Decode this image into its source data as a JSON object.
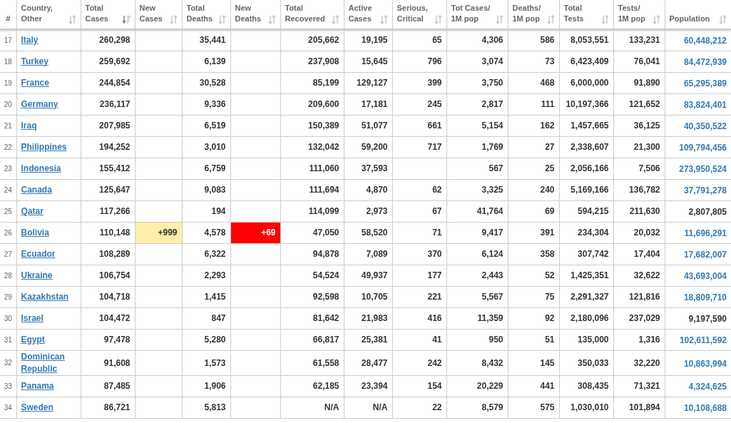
{
  "columns": [
    {
      "label": "#",
      "kind": "rank"
    },
    {
      "label": "Country,\nOther",
      "kind": "country",
      "sorted": false
    },
    {
      "label": "Total\nCases",
      "kind": "number",
      "sorted": true
    },
    {
      "label": "New\nCases",
      "kind": "new_cases",
      "sorted": false
    },
    {
      "label": "Total\nDeaths",
      "kind": "number",
      "sorted": false
    },
    {
      "label": "New\nDeaths",
      "kind": "new_deaths",
      "sorted": false
    },
    {
      "label": "Total\nRecovered",
      "kind": "number",
      "sorted": false
    },
    {
      "label": "Active\nCases",
      "kind": "number",
      "sorted": false
    },
    {
      "label": "Serious,\nCritical",
      "kind": "number",
      "sorted": false
    },
    {
      "label": "Tot Cases/\n1M pop",
      "kind": "number",
      "sorted": false
    },
    {
      "label": "Deaths/\n1M pop",
      "kind": "number",
      "sorted": false
    },
    {
      "label": "Total\nTests",
      "kind": "number",
      "sorted": false
    },
    {
      "label": "Tests/\n1M pop",
      "kind": "number",
      "sorted": false
    },
    {
      "label": "Population",
      "kind": "population",
      "sorted": false
    }
  ],
  "rows": [
    {
      "rank": "17",
      "country": "Italy",
      "total_cases": "260,298",
      "total_deaths": "35,441",
      "total_recovered": "205,662",
      "active_cases": "19,195",
      "serious_critical": "65",
      "tot_cases_1m": "4,306",
      "deaths_1m": "586",
      "total_tests": "8,053,551",
      "tests_1m": "133,231",
      "population": "60,448,212",
      "population_linked": true
    },
    {
      "rank": "18",
      "country": "Turkey",
      "total_cases": "259,692",
      "total_deaths": "6,139",
      "total_recovered": "237,908",
      "active_cases": "15,645",
      "serious_critical": "796",
      "tot_cases_1m": "3,074",
      "deaths_1m": "73",
      "total_tests": "6,423,409",
      "tests_1m": "76,041",
      "population": "84,472,939",
      "population_linked": true
    },
    {
      "rank": "19",
      "country": "France",
      "total_cases": "244,854",
      "total_deaths": "30,528",
      "total_recovered": "85,199",
      "active_cases": "129,127",
      "serious_critical": "399",
      "tot_cases_1m": "3,750",
      "deaths_1m": "468",
      "total_tests": "6,000,000",
      "tests_1m": "91,890",
      "population": "65,295,389",
      "population_linked": true
    },
    {
      "rank": "20",
      "country": "Germany",
      "total_cases": "236,117",
      "total_deaths": "9,336",
      "total_recovered": "209,600",
      "active_cases": "17,181",
      "serious_critical": "245",
      "tot_cases_1m": "2,817",
      "deaths_1m": "111",
      "total_tests": "10,197,366",
      "tests_1m": "121,652",
      "population": "83,824,401",
      "population_linked": true
    },
    {
      "rank": "21",
      "country": "Iraq",
      "total_cases": "207,985",
      "total_deaths": "6,519",
      "total_recovered": "150,389",
      "active_cases": "51,077",
      "serious_critical": "661",
      "tot_cases_1m": "5,154",
      "deaths_1m": "162",
      "total_tests": "1,457,665",
      "tests_1m": "36,125",
      "population": "40,350,522",
      "population_linked": true
    },
    {
      "rank": "22",
      "country": "Philippines",
      "total_cases": "194,252",
      "total_deaths": "3,010",
      "total_recovered": "132,042",
      "active_cases": "59,200",
      "serious_critical": "717",
      "tot_cases_1m": "1,769",
      "deaths_1m": "27",
      "total_tests": "2,338,607",
      "tests_1m": "21,300",
      "population": "109,794,456",
      "population_linked": true
    },
    {
      "rank": "23",
      "country": "Indonesia",
      "total_cases": "155,412",
      "total_deaths": "6,759",
      "total_recovered": "111,060",
      "active_cases": "37,593",
      "tot_cases_1m": "567",
      "deaths_1m": "25",
      "total_tests": "2,056,166",
      "tests_1m": "7,506",
      "population": "273,950,524",
      "population_linked": true
    },
    {
      "rank": "24",
      "country": "Canada",
      "total_cases": "125,647",
      "total_deaths": "9,083",
      "total_recovered": "111,694",
      "active_cases": "4,870",
      "serious_critical": "62",
      "tot_cases_1m": "3,325",
      "deaths_1m": "240",
      "total_tests": "5,169,166",
      "tests_1m": "136,782",
      "population": "37,791,278",
      "population_linked": true
    },
    {
      "rank": "25",
      "country": "Qatar",
      "total_cases": "117,266",
      "total_deaths": "194",
      "total_recovered": "114,099",
      "active_cases": "2,973",
      "serious_critical": "67",
      "tot_cases_1m": "41,764",
      "deaths_1m": "69",
      "total_tests": "594,215",
      "tests_1m": "211,630",
      "population": "2,807,805",
      "population_linked": false
    },
    {
      "rank": "26",
      "country": "Bolivia",
      "total_cases": "110,148",
      "new_cases": "+999",
      "total_deaths": "4,578",
      "new_deaths": "+69",
      "total_recovered": "47,050",
      "active_cases": "58,520",
      "serious_critical": "71",
      "tot_cases_1m": "9,417",
      "deaths_1m": "391",
      "total_tests": "234,304",
      "tests_1m": "20,032",
      "population": "11,696,291",
      "population_linked": true
    },
    {
      "rank": "27",
      "country": "Ecuador",
      "total_cases": "108,289",
      "total_deaths": "6,322",
      "total_recovered": "94,878",
      "active_cases": "7,089",
      "serious_critical": "370",
      "tot_cases_1m": "6,124",
      "deaths_1m": "358",
      "total_tests": "307,742",
      "tests_1m": "17,404",
      "population": "17,682,007",
      "population_linked": true
    },
    {
      "rank": "28",
      "country": "Ukraine",
      "total_cases": "106,754",
      "total_deaths": "2,293",
      "total_recovered": "54,524",
      "active_cases": "49,937",
      "serious_critical": "177",
      "tot_cases_1m": "2,443",
      "deaths_1m": "52",
      "total_tests": "1,425,351",
      "tests_1m": "32,622",
      "population": "43,693,004",
      "population_linked": true
    },
    {
      "rank": "29",
      "country": "Kazakhstan",
      "total_cases": "104,718",
      "total_deaths": "1,415",
      "total_recovered": "92,598",
      "active_cases": "10,705",
      "serious_critical": "221",
      "tot_cases_1m": "5,567",
      "deaths_1m": "75",
      "total_tests": "2,291,327",
      "tests_1m": "121,816",
      "population": "18,809,710",
      "population_linked": true
    },
    {
      "rank": "30",
      "country": "Israel",
      "total_cases": "104,472",
      "total_deaths": "847",
      "total_recovered": "81,642",
      "active_cases": "21,983",
      "serious_critical": "416",
      "tot_cases_1m": "11,359",
      "deaths_1m": "92",
      "total_tests": "2,180,096",
      "tests_1m": "237,029",
      "population": "9,197,590",
      "population_linked": false
    },
    {
      "rank": "31",
      "country": "Egypt",
      "total_cases": "97,478",
      "total_deaths": "5,280",
      "total_recovered": "66,817",
      "active_cases": "25,381",
      "serious_critical": "41",
      "tot_cases_1m": "950",
      "deaths_1m": "51",
      "total_tests": "135,000",
      "tests_1m": "1,316",
      "population": "102,611,592",
      "population_linked": true
    },
    {
      "rank": "32",
      "country": "Dominican Republic",
      "total_cases": "91,608",
      "total_deaths": "1,573",
      "total_recovered": "61,558",
      "active_cases": "28,477",
      "serious_critical": "242",
      "tot_cases_1m": "8,432",
      "deaths_1m": "145",
      "total_tests": "350,033",
      "tests_1m": "32,220",
      "population": "10,863,994",
      "population_linked": true
    },
    {
      "rank": "33",
      "country": "Panama",
      "total_cases": "87,485",
      "total_deaths": "1,906",
      "total_recovered": "62,185",
      "active_cases": "23,394",
      "serious_critical": "154",
      "tot_cases_1m": "20,229",
      "deaths_1m": "441",
      "total_tests": "308,435",
      "tests_1m": "71,321",
      "population": "4,324,625",
      "population_linked": true
    },
    {
      "rank": "34",
      "country": "Sweden",
      "total_cases": "86,721",
      "total_deaths": "5,813",
      "total_recovered": "N/A",
      "active_cases": "N/A",
      "serious_critical": "22",
      "tot_cases_1m": "8,579",
      "deaths_1m": "575",
      "total_tests": "1,030,010",
      "tests_1m": "101,894",
      "population": "10,108,688",
      "population_linked": true
    }
  ]
}
